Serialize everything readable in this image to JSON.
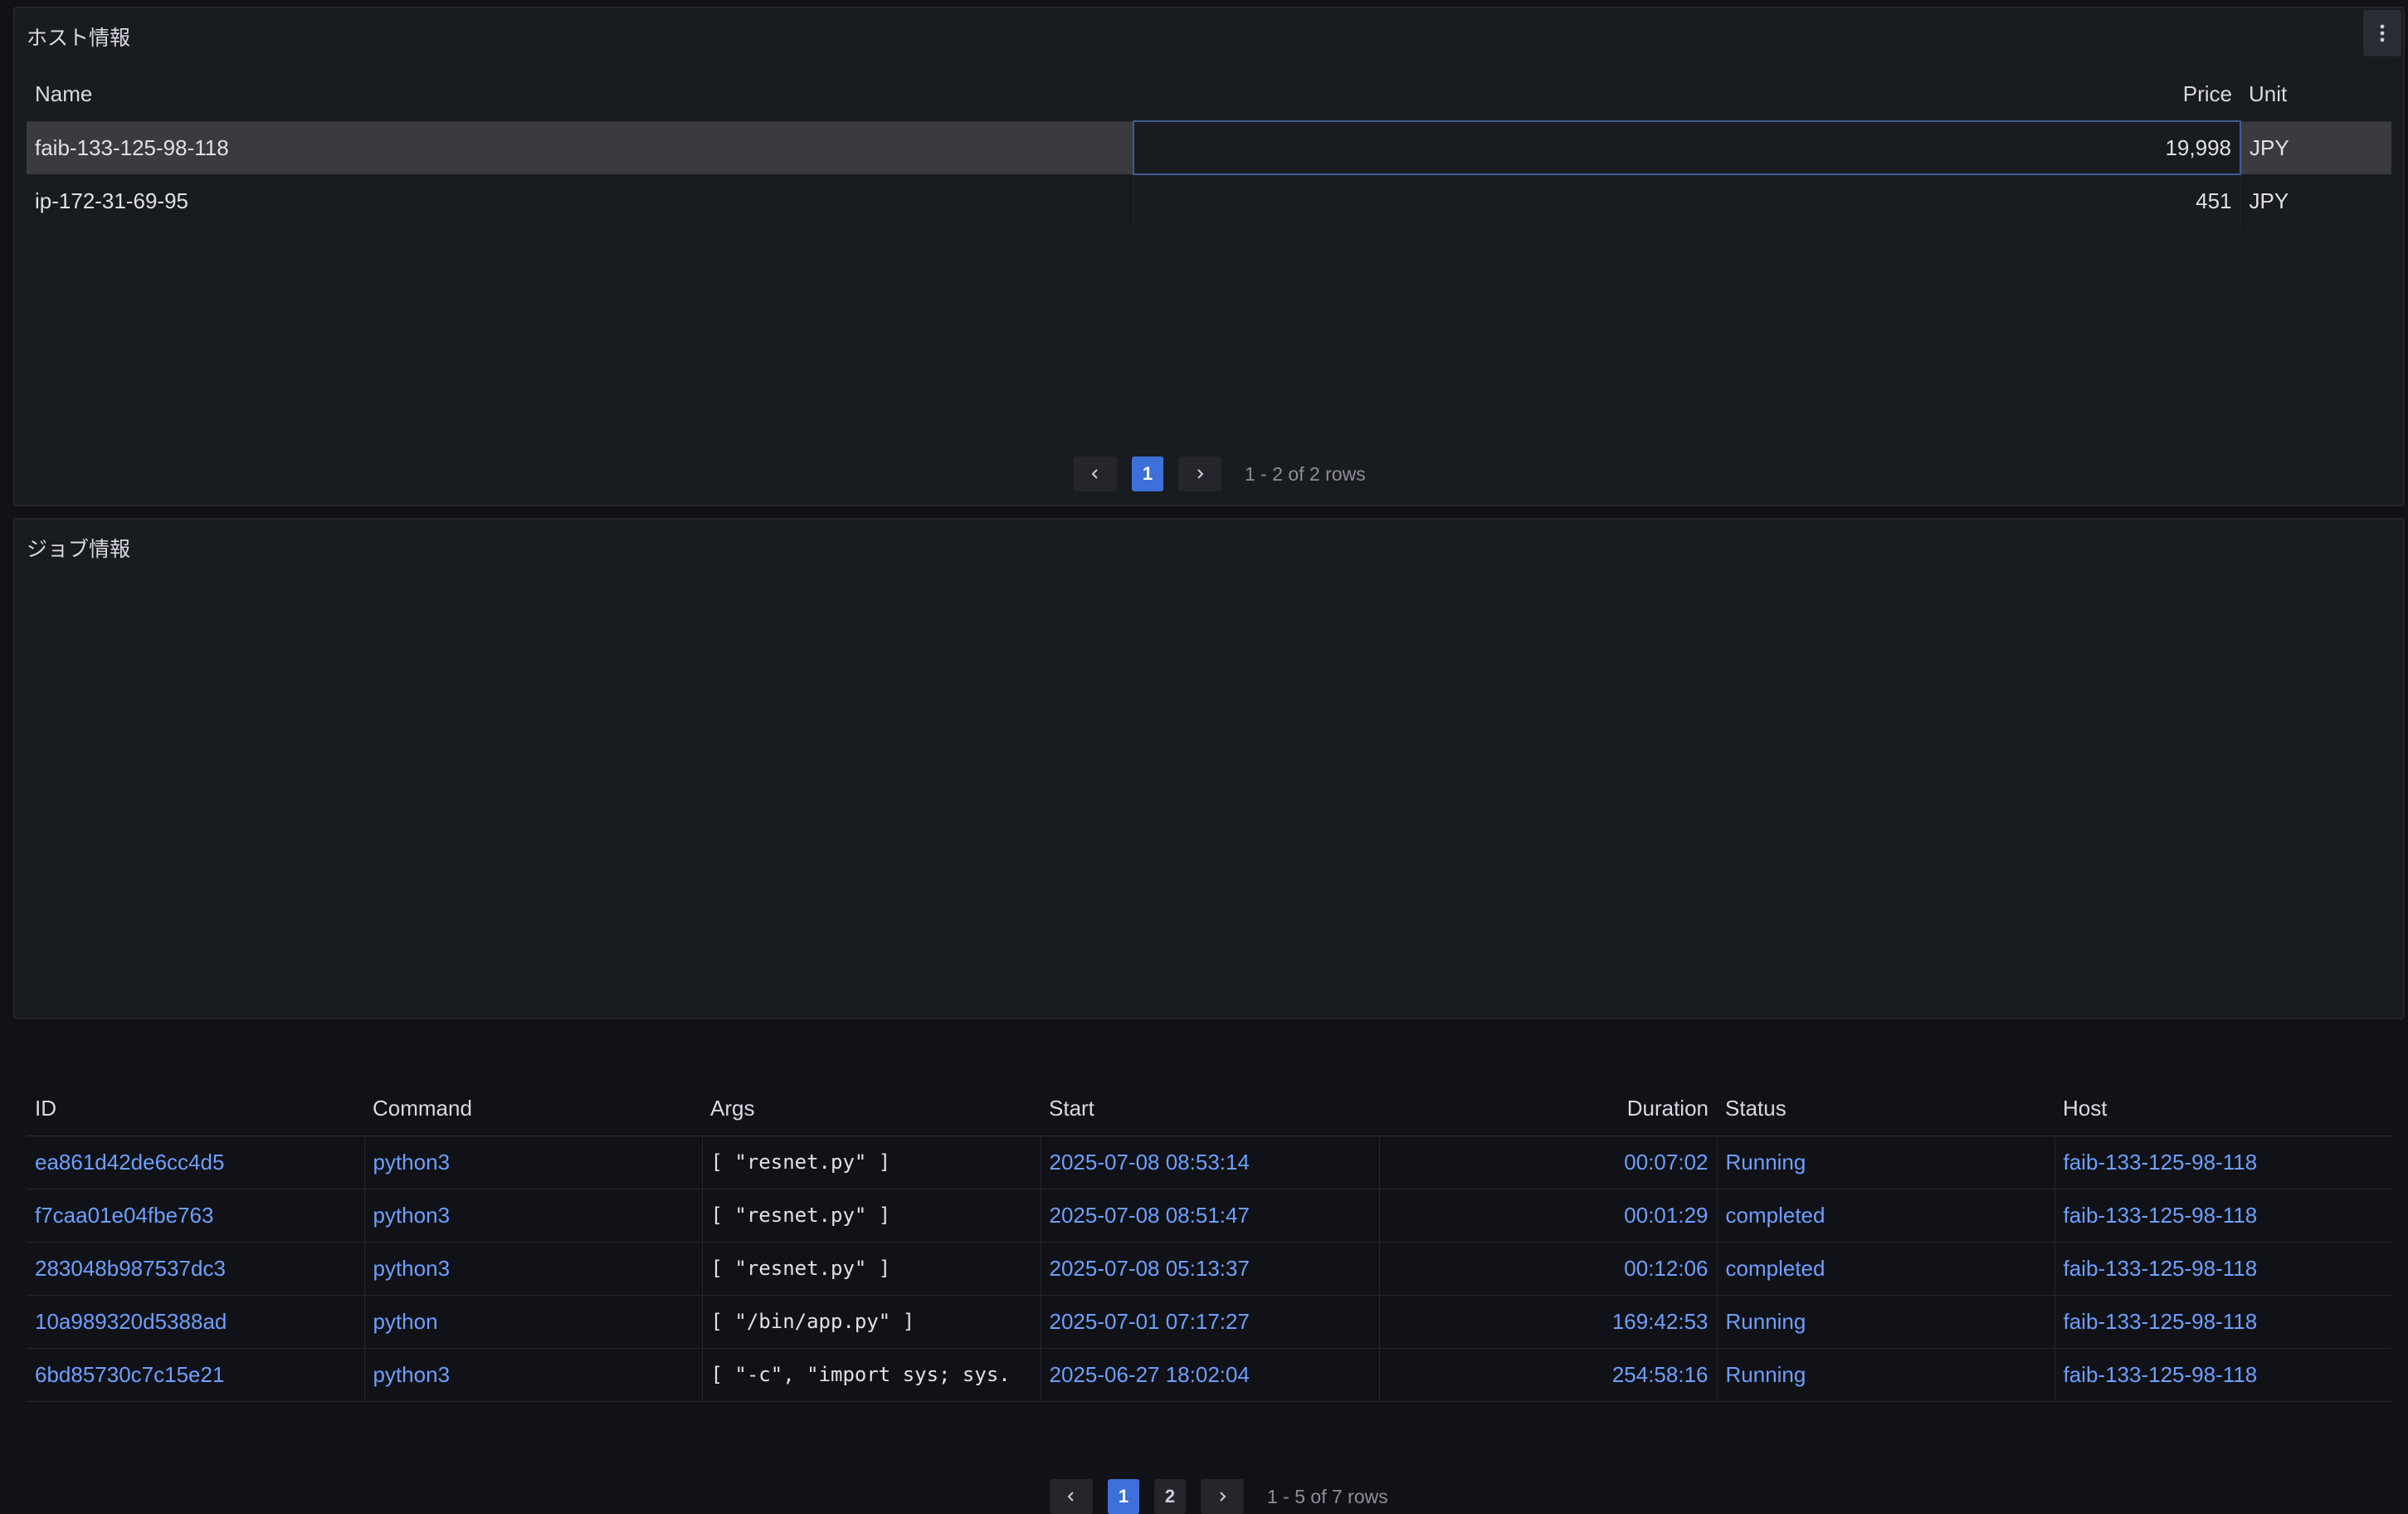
{
  "host_panel": {
    "title": "ホスト情報",
    "columns": [
      "Name",
      "Price",
      "Unit"
    ],
    "rows": [
      {
        "name": "faib-133-125-98-118",
        "price": "19,998",
        "unit": "JPY"
      },
      {
        "name": "ip-172-31-69-95",
        "price": "451",
        "unit": "JPY"
      }
    ],
    "pagination": {
      "prev_icon": "chevron-left-icon",
      "next_icon": "chevron-right-icon",
      "pages": [
        "1"
      ],
      "current_page": "1",
      "info": "1 - 2 of 2 rows"
    }
  },
  "job_panel": {
    "title": "ジョブ情報",
    "columns": [
      "ID",
      "Command",
      "Args",
      "Start",
      "Duration",
      "Status",
      "Host"
    ],
    "rows": [
      {
        "id": "ea861d42de6cc4d5",
        "command": "python3",
        "args": "[ \"resnet.py\" ]",
        "start": "2025-07-08 08:53:14",
        "duration": "00:07:02",
        "status": "Running",
        "host": "faib-133-125-98-118"
      },
      {
        "id": "f7caa01e04fbe763",
        "command": "python3",
        "args": "[ \"resnet.py\" ]",
        "start": "2025-07-08 08:51:47",
        "duration": "00:01:29",
        "status": "completed",
        "host": "faib-133-125-98-118"
      },
      {
        "id": "283048b987537dc3",
        "command": "python3",
        "args": "[ \"resnet.py\" ]",
        "start": "2025-07-08 05:13:37",
        "duration": "00:12:06",
        "status": "completed",
        "host": "faib-133-125-98-118"
      },
      {
        "id": "10a989320d5388ad",
        "command": "python",
        "args": "[ \"/bin/app.py\" ]",
        "start": "2025-07-01 07:17:27",
        "duration": "169:42:53",
        "status": "Running",
        "host": "faib-133-125-98-118"
      },
      {
        "id": "6bd85730c7c15e21",
        "command": "python3",
        "args": "[ \"-c\", \"import sys; sys.",
        "start": "2025-06-27 18:02:04",
        "duration": "254:58:16",
        "status": "Running",
        "host": "faib-133-125-98-118"
      }
    ],
    "pagination": {
      "prev_icon": "chevron-left-icon",
      "next_icon": "chevron-right-icon",
      "pages": [
        "1",
        "2"
      ],
      "current_page": "1",
      "info": "1 - 5 of 7 rows"
    }
  },
  "colors": {
    "background": "#111217",
    "panel": "#181b1f",
    "link": "#6e9fff",
    "accent": "#3d71d9",
    "selected_row": "#3a3b40"
  },
  "icons": {
    "panel_menu": "kebab-menu-icon"
  }
}
